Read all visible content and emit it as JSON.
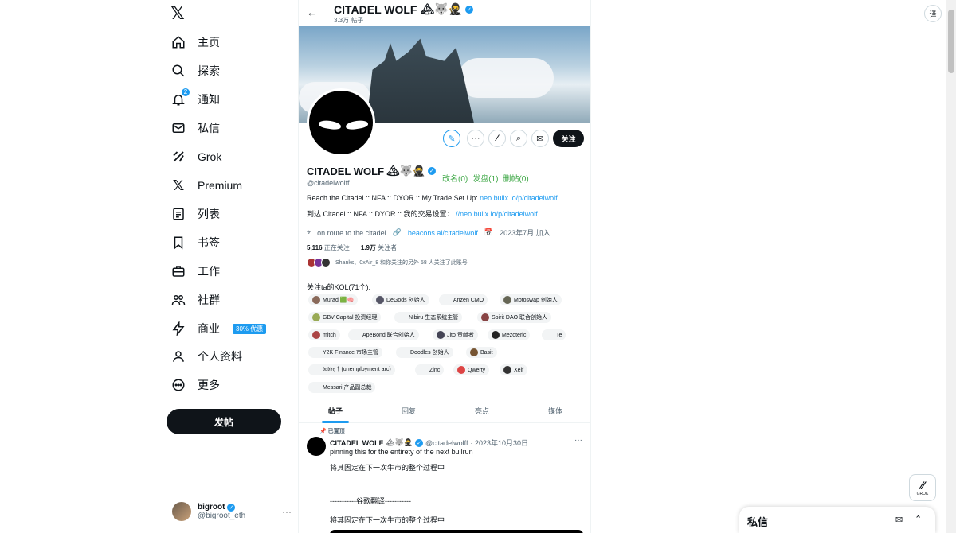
{
  "nav": {
    "logo": "𝕏",
    "items": [
      {
        "label": "主页",
        "icon": "home-icon"
      },
      {
        "label": "探索",
        "icon": "search-icon"
      },
      {
        "label": "通知",
        "icon": "bell-icon",
        "badge": "2"
      },
      {
        "label": "私信",
        "icon": "mail-icon"
      },
      {
        "label": "Grok",
        "icon": "grok-icon"
      },
      {
        "label": "Premium",
        "icon": "x-premium-icon"
      },
      {
        "label": "列表",
        "icon": "list-icon"
      },
      {
        "label": "书签",
        "icon": "bookmark-icon"
      },
      {
        "label": "工作",
        "icon": "briefcase-icon"
      },
      {
        "label": "社群",
        "icon": "community-icon"
      },
      {
        "label": "商业",
        "icon": "lightning-icon",
        "promo": "30% 优惠"
      },
      {
        "label": "个人资料",
        "icon": "profile-icon"
      },
      {
        "label": "更多",
        "icon": "more-circle-icon"
      }
    ],
    "post_button": "发帖"
  },
  "account": {
    "name": "bigroot",
    "handle": "@bigroot_eth",
    "more": "···"
  },
  "topbar": {
    "title": "CITADEL WOLF",
    "emoji": "🏔🐺🥷",
    "posts": "3.3万 帖子",
    "back": "←"
  },
  "profile": {
    "name": "CITADEL WOLF",
    "emoji": "🏔🐺🥷",
    "handle": "@citadelwolff",
    "follow_button": "关注",
    "green_links": [
      "改名(0)",
      "发盘(1)",
      "删帖(0)"
    ],
    "bio_line1_text": "Reach the Citadel :: NFA :: DYOR :: My Trade Set Up: ",
    "bio_line1_link": "neo.bullx.io/p/citadelwolf",
    "bio_line2_text": "到达 Citadel :: NFA :: DYOR :: 我的交易设置：",
    "bio_line2_link": "//neo.bullx.io/p/citadelwolf",
    "location": "on route to the citadel",
    "website": "beacons.ai/citadelwolf",
    "joined": "2023年7月 加入",
    "following_count": "5,116",
    "following_label": "正在关注",
    "followers_count": "1.9万",
    "followers_label": "关注者",
    "followed_by": "Shanks、0xAir_8 和你关注的另外 58 人关注了此账号"
  },
  "kol": {
    "title": "关注ta的KOL(71个):",
    "tags": [
      "Murad 🟩🧠",
      "DeGods 创始人",
      "Anzen CMO",
      "Motoswap 创始人",
      "GBV Capital 投资经理",
      "Nibiru 生态系统主管",
      "Spirit DAO 联合创始人",
      "mitch",
      "ApeBond 联合创始人",
      "Jito 贡献者",
      "Mezoteric",
      "Te",
      "Y2K Finance 市场主管",
      "Doodles 创始人",
      "Basit",
      "𝔟𝔬𝔟𝔟𝔶 † (unemployment arc)",
      "Zinc",
      "Qwerty",
      "Xelf",
      "Messari 产品副总裁"
    ]
  },
  "tabs": [
    "帖子",
    "回复",
    "亮点",
    "媒体"
  ],
  "tweet": {
    "pinned": "已置顶",
    "name": "CITADEL WOLF",
    "emoji": "🏔🐺🥷",
    "handle": "@citadelwolff",
    "date": "· 2023年10月30日",
    "line1": "pinning this for the entirety of the next bullrun",
    "line2": "将其固定在下一次牛市的整个过程中",
    "line3": "-----------谷歌翻译-----------",
    "line4": "将其固定在下一次牛市的整个过程中"
  },
  "right": {
    "translate": "译",
    "dm_title": "私信",
    "grok_label": "GROK"
  }
}
